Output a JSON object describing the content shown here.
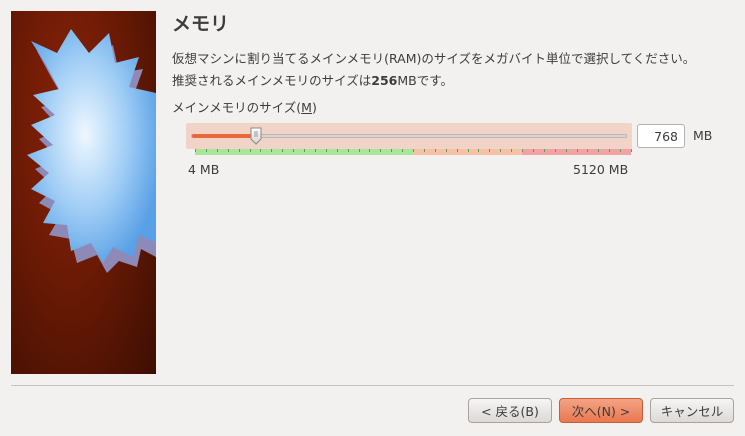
{
  "page": {
    "title": "メモリ",
    "description_line1": "仮想マシンに割り当てるメインメモリ(RAM)のサイズをメガバイト単位で選択してください。",
    "description_line2_pre": "推奨されるメインメモリのサイズは",
    "recommended_value": "256",
    "description_line2_post": "MBです。"
  },
  "memory": {
    "label_pre": "メインメモリのサイズ(",
    "label_mnemonic": "M",
    "label_post": ")",
    "value": "768",
    "unit": "MB",
    "min_label": "4 MB",
    "max_label": "5120 MB",
    "min": 4,
    "max": 5120,
    "current": 768,
    "safe_limit": 2560,
    "warn_limit": 3840
  },
  "buttons": {
    "back_label": "< 戻る(B)",
    "next_label": "次へ(N) >",
    "cancel_label": "キャンセル"
  },
  "colors": {
    "accent": "#e9683a",
    "safe": "#a9e59a",
    "warning": "#f6c1a5",
    "danger": "#f1a3a3",
    "side_bg": "#6b1a05"
  },
  "icons": {
    "side_image": "star-burst-icon",
    "slider_handle": "slider-handle"
  }
}
